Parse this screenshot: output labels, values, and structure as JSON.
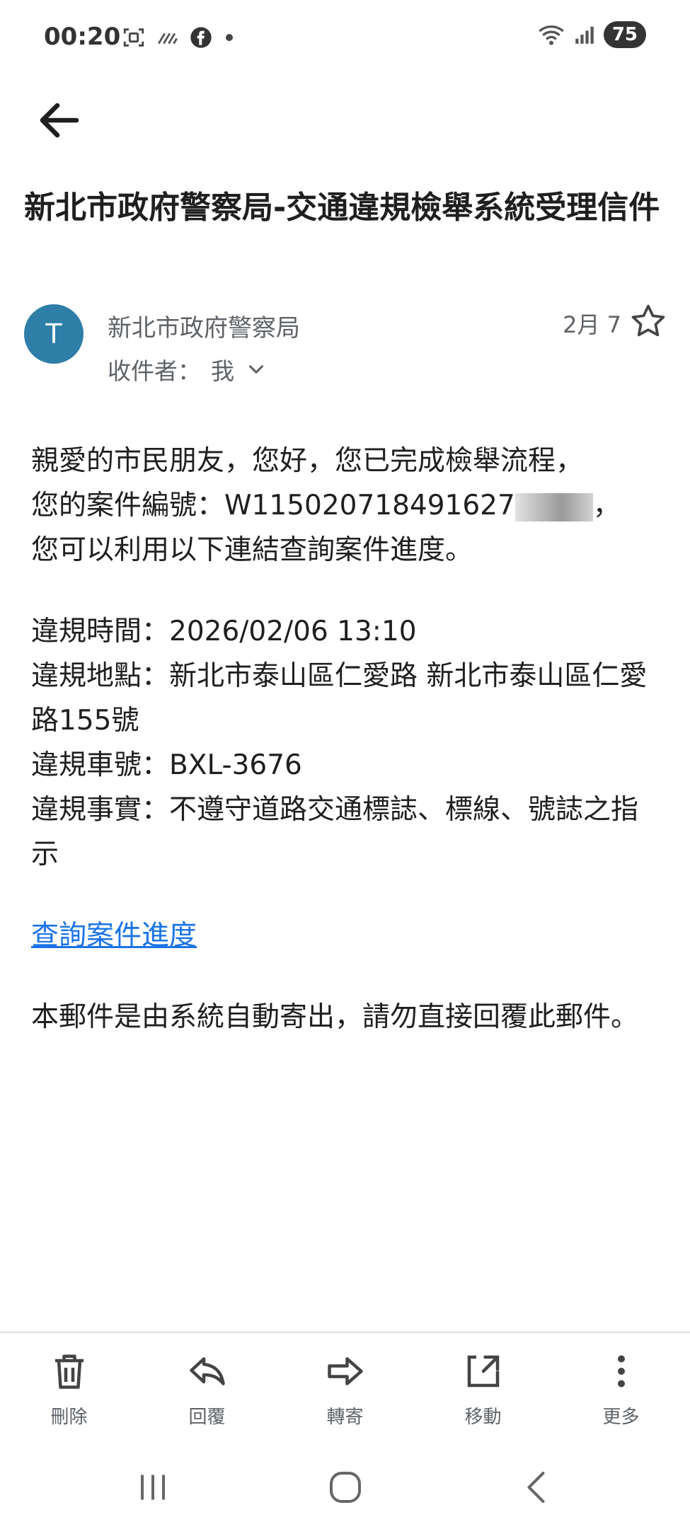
{
  "status_bar": {
    "time": "00:20",
    "battery": "75",
    "icons": [
      "screenshot-icon",
      "wifi-calling-icon",
      "facebook-icon",
      "notification-dot-icon",
      "wifi-icon",
      "signal-icon"
    ]
  },
  "header": {
    "back_icon": "arrow-left-icon"
  },
  "email": {
    "subject": "新北市政府警察局-交通違規檢舉系統受理信件",
    "sender_initial": "T",
    "sender_name": "新北市政府警察局",
    "recipient_label": "收件者：",
    "recipient_value": "我",
    "date": "2月 7",
    "body": {
      "greeting": "親愛的市民朋友，您好，您已完成檢舉流程，",
      "case_prefix": "您的案件編號：W115020718491627",
      "case_suffix": "，",
      "query_hint": "您可以利用以下連結查詢案件進度。",
      "violation_time": "違規時間：2026/02/06 13:10",
      "violation_place": "違規地點：新北市泰山區仁愛路 新北市泰山區仁愛路155號",
      "violation_plate": "違規車號：BXL-3676",
      "violation_fact": "違規事實：不遵守道路交通標誌、標線、號誌之指示",
      "link_text": "查詢案件進度",
      "footer": "本郵件是由系統自動寄出，請勿直接回覆此郵件。"
    }
  },
  "actions": [
    {
      "label": "刪除",
      "icon": "trash-icon"
    },
    {
      "label": "回覆",
      "icon": "reply-icon"
    },
    {
      "label": "轉寄",
      "icon": "forward-icon"
    },
    {
      "label": "移動",
      "icon": "move-icon"
    },
    {
      "label": "更多",
      "icon": "more-vert-icon"
    }
  ],
  "colors": {
    "avatar": "#2e7ea8",
    "link": "#1a73e8",
    "secondary_text": "#5f6368"
  }
}
